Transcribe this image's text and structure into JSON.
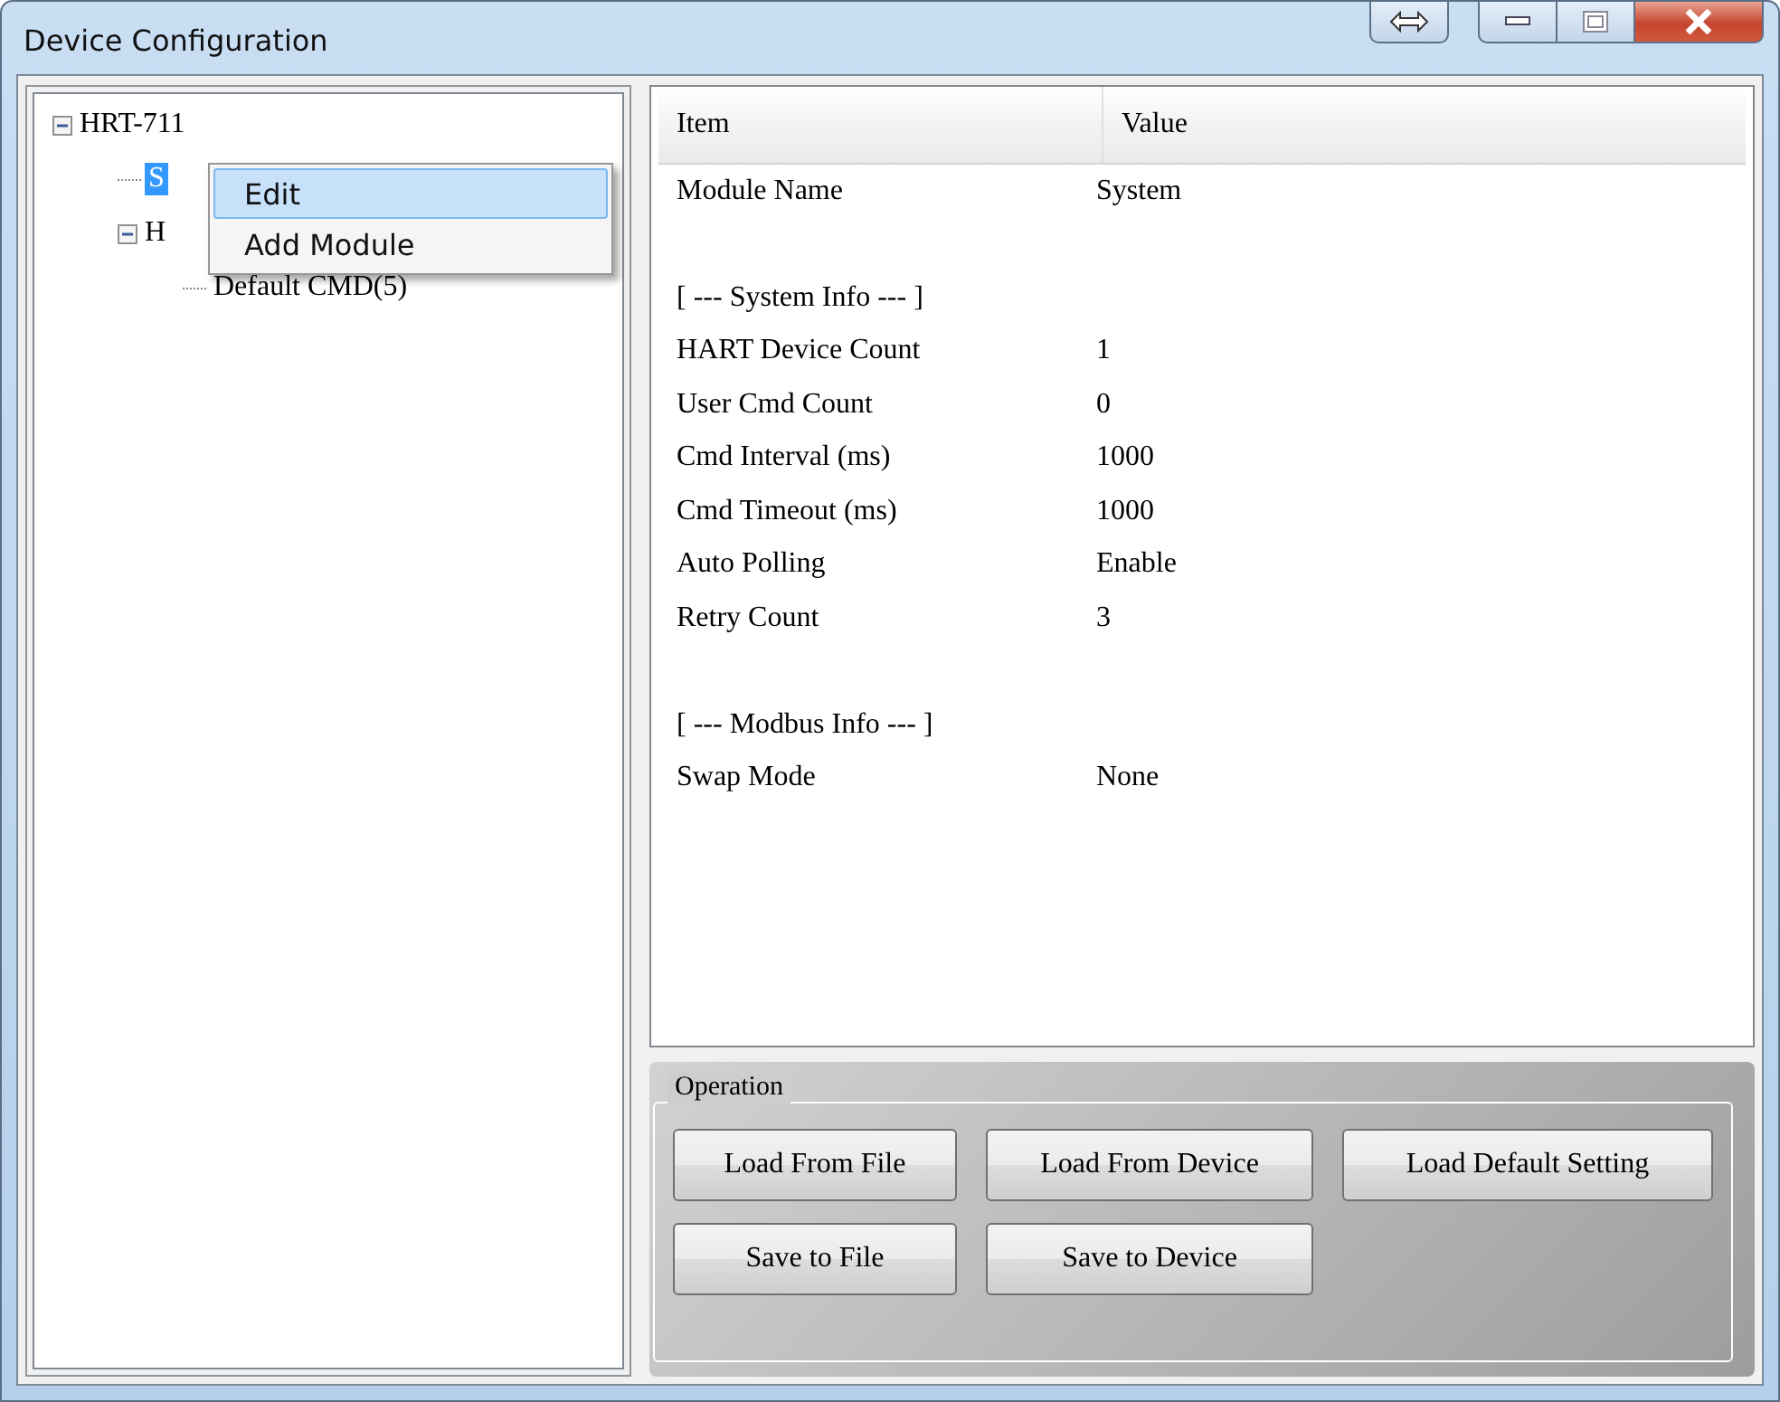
{
  "window": {
    "title": "Device Configuration"
  },
  "tree": [
    {
      "label": "HRT-711",
      "expanded": true,
      "selected": false,
      "children": [
        {
          "label": "S",
          "selected": true
        },
        {
          "label": "H",
          "expanded": true,
          "selected": false,
          "children": [
            {
              "label": "Default CMD(5)",
              "selected": false
            }
          ]
        }
      ]
    }
  ],
  "context_menu": [
    {
      "label": "Edit",
      "selected": true
    },
    {
      "label": "Add Module",
      "selected": false
    }
  ],
  "list": {
    "columns": [
      "Item",
      "Value"
    ],
    "rows": [
      {
        "kind": "pair",
        "item": "Module Name",
        "value": "System"
      },
      {
        "kind": "blank"
      },
      {
        "kind": "heading",
        "item": "[ --- System Info --- ]"
      },
      {
        "kind": "pair",
        "item": "HART Device Count",
        "value": "1"
      },
      {
        "kind": "pair",
        "item": "User Cmd Count",
        "value": "0"
      },
      {
        "kind": "pair",
        "item": "Cmd Interval (ms)",
        "value": "1000"
      },
      {
        "kind": "pair",
        "item": "Cmd Timeout (ms)",
        "value": "1000"
      },
      {
        "kind": "pair",
        "item": "Auto Polling",
        "value": "Enable"
      },
      {
        "kind": "pair",
        "item": "Retry Count",
        "value": "3"
      },
      {
        "kind": "blank"
      },
      {
        "kind": "heading",
        "item": "[ --- Modbus Info --- ]"
      },
      {
        "kind": "pair",
        "item": "Swap Mode",
        "value": "None"
      }
    ]
  },
  "operation": {
    "title": "Operation",
    "button_rows": [
      [
        "Load From File",
        "Load From Device",
        "Load Default Setting"
      ],
      [
        "Save to File",
        "Save to Device"
      ]
    ]
  }
}
